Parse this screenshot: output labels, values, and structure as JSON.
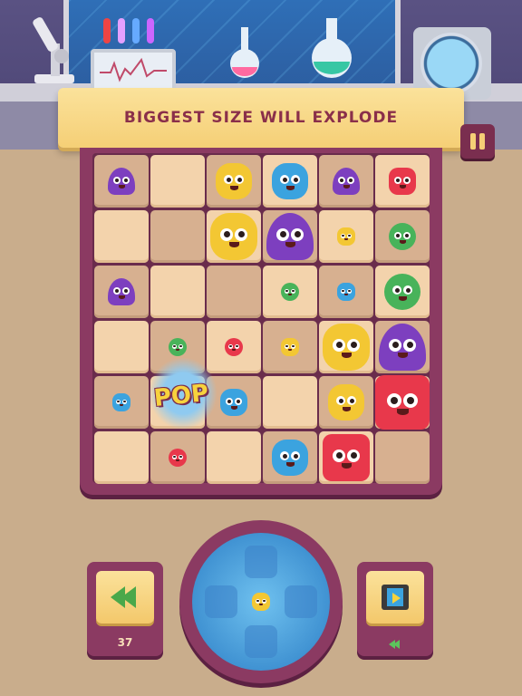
{
  "banner": {
    "text": "BIGGEST SIZE WILL EXPLODE"
  },
  "pop_text": "POP",
  "undo_button": {
    "count": "37"
  },
  "colors": {
    "board": "#8b3a62",
    "tile_light": "#f3d3ac",
    "tile_dark": "#d7b090",
    "banner": "#f5cf76",
    "banner_text": "#8a2f4a"
  },
  "board": {
    "rows": 6,
    "cols": 6,
    "monsters": [
      {
        "row": 0,
        "col": 0,
        "type": "purple",
        "size": "small"
      },
      {
        "row": 0,
        "col": 2,
        "type": "yellow",
        "size": "medium"
      },
      {
        "row": 0,
        "col": 3,
        "type": "blue",
        "size": "medium"
      },
      {
        "row": 0,
        "col": 4,
        "type": "purple",
        "size": "small"
      },
      {
        "row": 0,
        "col": 5,
        "type": "red",
        "size": "small"
      },
      {
        "row": 1,
        "col": 2,
        "type": "yellow",
        "size": "large"
      },
      {
        "row": 1,
        "col": 3,
        "type": "purple",
        "size": "large"
      },
      {
        "row": 1,
        "col": 4,
        "type": "yellow",
        "size": "tiny"
      },
      {
        "row": 1,
        "col": 5,
        "type": "green",
        "size": "small"
      },
      {
        "row": 2,
        "col": 0,
        "type": "purple",
        "size": "small"
      },
      {
        "row": 2,
        "col": 3,
        "type": "green",
        "size": "tiny"
      },
      {
        "row": 2,
        "col": 4,
        "type": "blue",
        "size": "tiny"
      },
      {
        "row": 2,
        "col": 5,
        "type": "green",
        "size": "medium"
      },
      {
        "row": 3,
        "col": 1,
        "type": "green",
        "size": "tiny"
      },
      {
        "row": 3,
        "col": 2,
        "type": "red",
        "size": "tiny"
      },
      {
        "row": 3,
        "col": 3,
        "type": "yellow",
        "size": "tiny"
      },
      {
        "row": 3,
        "col": 4,
        "type": "yellow",
        "size": "large"
      },
      {
        "row": 3,
        "col": 5,
        "type": "purple",
        "size": "large"
      },
      {
        "row": 4,
        "col": 0,
        "type": "blue",
        "size": "tiny"
      },
      {
        "row": 4,
        "col": 2,
        "type": "blue",
        "size": "small"
      },
      {
        "row": 4,
        "col": 4,
        "type": "yellow",
        "size": "medium"
      },
      {
        "row": 4,
        "col": 5,
        "type": "red",
        "size": "xlarge"
      },
      {
        "row": 5,
        "col": 1,
        "type": "red",
        "size": "tiny"
      },
      {
        "row": 5,
        "col": 3,
        "type": "blue",
        "size": "medium"
      },
      {
        "row": 5,
        "col": 4,
        "type": "red",
        "size": "large"
      }
    ]
  },
  "joystick": {
    "center_monster": {
      "type": "yellow",
      "size": "tiny"
    }
  },
  "icons": {
    "undo": "rewind-icon",
    "video": "film-play-icon",
    "pause": "pause-icon"
  }
}
